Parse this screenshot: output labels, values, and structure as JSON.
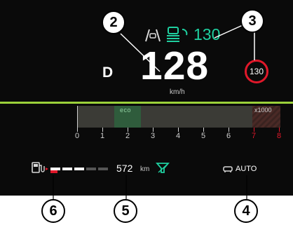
{
  "cluster": {
    "gear": "D",
    "speed": "128",
    "speed_unit": "km/h",
    "cruise": {
      "set_speed": "130",
      "color": "#1fd0a0"
    },
    "speed_limit": "130",
    "tachometer": {
      "eco_label": "eco",
      "multiplier_label": "x1000",
      "ticks": [
        "0",
        "1",
        "2",
        "3",
        "4",
        "5",
        "6",
        "7",
        "8"
      ],
      "redline_from": 7
    },
    "fuel": {
      "level_fraction": 0.65
    },
    "range": {
      "value": "572",
      "unit": "km"
    },
    "lighting_mode": "AUTO"
  },
  "callouts": [
    "2",
    "3",
    "6",
    "5",
    "4"
  ],
  "colors": {
    "accent_green": "#9bd03a",
    "warning_red": "#e0182a",
    "cruise_teal": "#1fd0a0"
  }
}
